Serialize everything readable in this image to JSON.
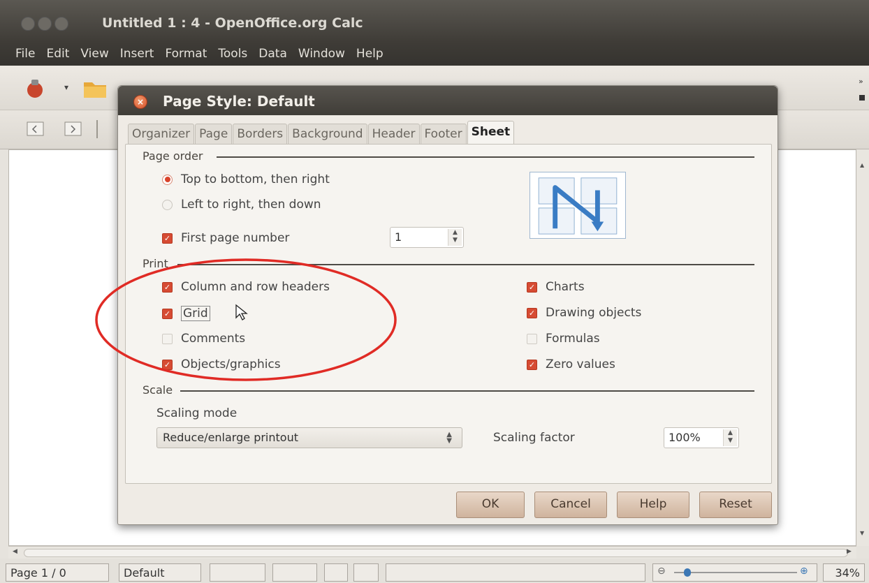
{
  "window": {
    "title": "Untitled 1 : 4 - OpenOffice.org Calc"
  },
  "menubar": {
    "items": [
      "File",
      "Edit",
      "View",
      "Insert",
      "Format",
      "Tools",
      "Data",
      "Window",
      "Help"
    ]
  },
  "dialog": {
    "title": "Page Style: Default",
    "tabs": [
      "Organizer",
      "Page",
      "Borders",
      "Background",
      "Header",
      "Footer",
      "Sheet"
    ],
    "active_tab": "Sheet",
    "page_order": {
      "label": "Page order",
      "top_to_bottom": {
        "label": "Top to bottom, then right",
        "selected": true
      },
      "left_to_right": {
        "label": "Left to right, then down",
        "selected": false
      },
      "first_page_number": {
        "label": "First page number",
        "checked": true,
        "value": "1"
      }
    },
    "print": {
      "label": "Print",
      "column_row_headers": {
        "label": "Column and row headers",
        "checked": true
      },
      "grid": {
        "label": "Grid",
        "checked": true
      },
      "comments": {
        "label": "Comments",
        "checked": false
      },
      "objects_graphics": {
        "label": "Objects/graphics",
        "checked": true
      },
      "charts": {
        "label": "Charts",
        "checked": true
      },
      "drawing_objects": {
        "label": "Drawing objects",
        "checked": true
      },
      "formulas": {
        "label": "Formulas",
        "checked": false
      },
      "zero_values": {
        "label": "Zero values",
        "checked": true
      }
    },
    "scale": {
      "label": "Scale",
      "scaling_mode_label": "Scaling mode",
      "scaling_mode_value": "Reduce/enlarge printout",
      "scaling_factor_label": "Scaling factor",
      "scaling_factor_value": "100%"
    },
    "buttons": {
      "ok": "OK",
      "cancel": "Cancel",
      "help": "Help",
      "reset": "Reset"
    }
  },
  "statusbar": {
    "page": "Page 1 / 0",
    "style": "Default",
    "zoom": "34%"
  },
  "colors": {
    "accent": "#d64b33",
    "highlight_ellipse": "#e02b25",
    "title_bar": "#3f3c37",
    "order_arrow": "#3a7cc4"
  }
}
